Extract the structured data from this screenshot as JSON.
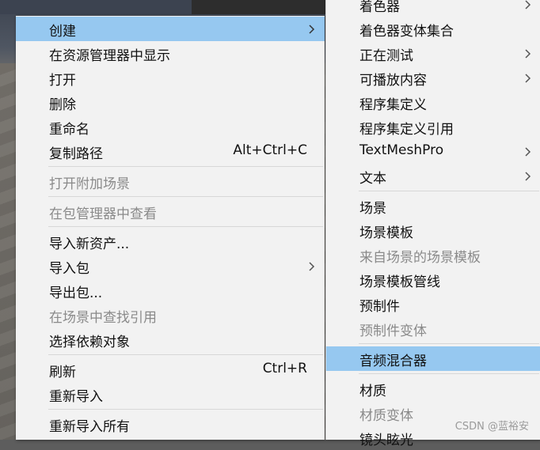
{
  "context_menu": {
    "items": [
      {
        "label": "创建",
        "submenu": true
      },
      {
        "label": "在资源管理器中显示"
      },
      {
        "label": "打开"
      },
      {
        "label": "删除"
      },
      {
        "label": "重命名"
      },
      {
        "label": "复制路径",
        "shortcut": "Alt+Ctrl+C"
      },
      {
        "label": "打开附加场景"
      },
      {
        "label": "在包管理器中查看"
      },
      {
        "label": "导入新资产..."
      },
      {
        "label": "导入包",
        "submenu": true
      },
      {
        "label": "导出包..."
      },
      {
        "label": "在场景中查找引用"
      },
      {
        "label": "选择依赖对象"
      },
      {
        "label": "刷新",
        "shortcut": "Ctrl+R"
      },
      {
        "label": "重新导入"
      },
      {
        "label": "重新导入所有"
      }
    ]
  },
  "create_submenu": {
    "items": [
      {
        "label": "着色器",
        "submenu": true
      },
      {
        "label": "着色器变体集合"
      },
      {
        "label": "正在测试",
        "submenu": true
      },
      {
        "label": "可播放内容",
        "submenu": true
      },
      {
        "label": "程序集定义"
      },
      {
        "label": "程序集定义引用"
      },
      {
        "label": "TextMeshPro",
        "submenu": true
      },
      {
        "label": "文本",
        "submenu": true
      },
      {
        "label": "场景"
      },
      {
        "label": "场景模板"
      },
      {
        "label": "来自场景的场景模板"
      },
      {
        "label": "场景模板管线"
      },
      {
        "label": "预制件"
      },
      {
        "label": "预制件变体"
      },
      {
        "label": "音频混合器"
      },
      {
        "label": "材质"
      },
      {
        "label": "材质变体"
      },
      {
        "label": "镜头眩光"
      }
    ]
  },
  "watermark": "CSDN @蓝裕安",
  "colors": {
    "highlight": "#96c8f0",
    "menu_bg": "#f2f2f2",
    "disabled_text": "#8a8a8a"
  }
}
